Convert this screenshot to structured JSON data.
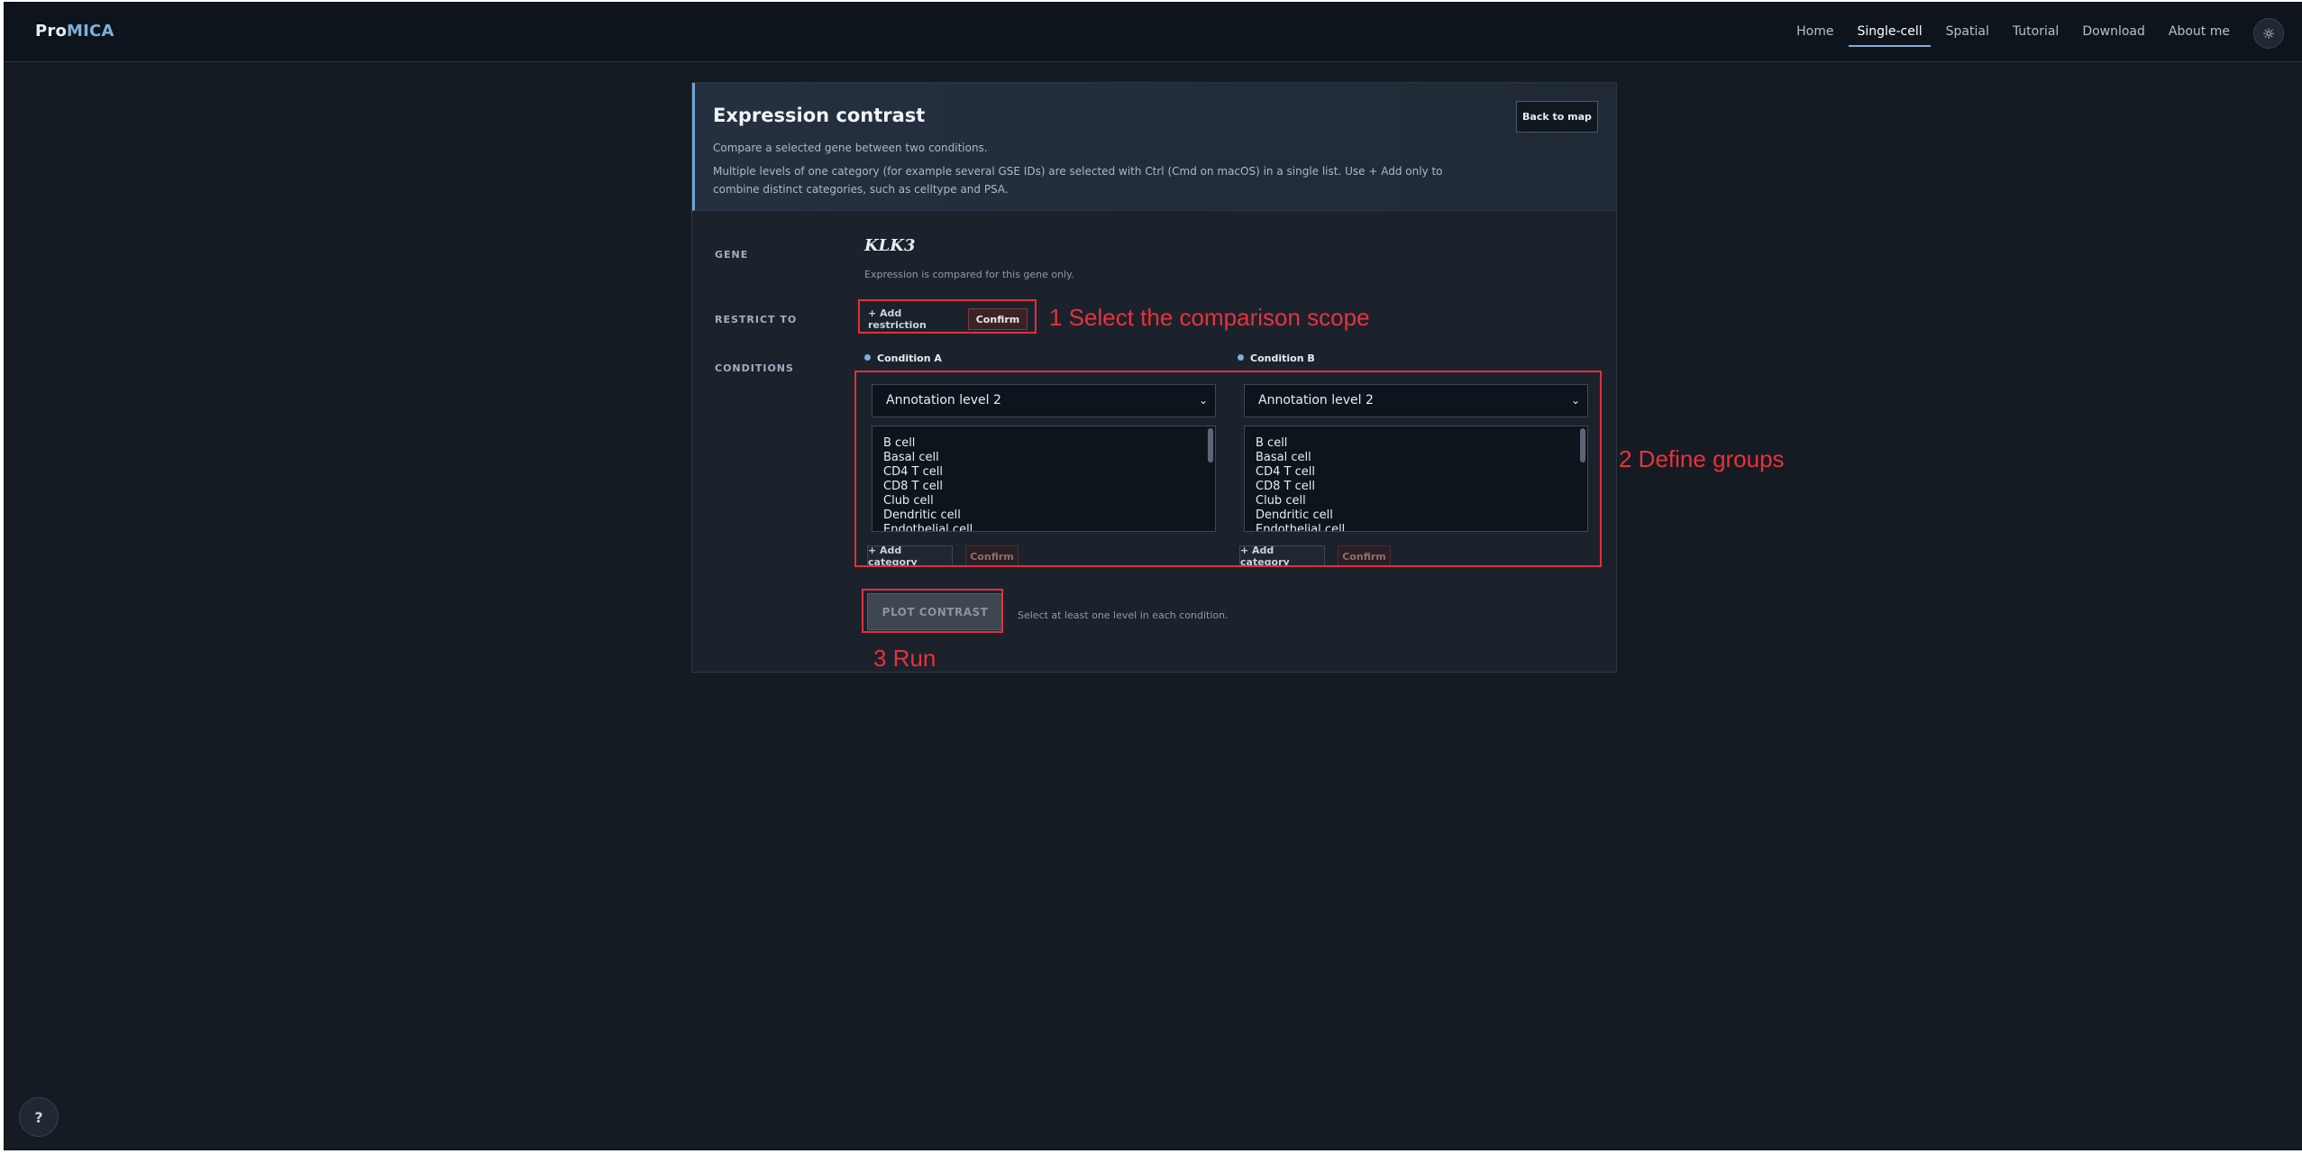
{
  "brand": {
    "part1": "Pro",
    "part2": "MICA"
  },
  "nav": {
    "items": [
      "Home",
      "Single-cell",
      "Spatial",
      "Tutorial",
      "Download",
      "About me"
    ],
    "active": "Single-cell"
  },
  "theme_icon": "sun-icon",
  "card": {
    "title": "Expression contrast",
    "subtitle": "Compare a selected gene between two conditions.",
    "note": "Multiple levels of one category (for example several GSE IDs) are selected with Ctrl (Cmd on macOS) in a single list. Use + Add only to combine distinct categories, such as celltype and PSA.",
    "back_label": "Back to map"
  },
  "gene": {
    "label": "GENE",
    "value": "KLK3",
    "hint": "Expression is compared for this gene only."
  },
  "restrict": {
    "label": "RESTRICT TO",
    "add_label": "+ Add restriction",
    "confirm_label": "Confirm"
  },
  "conditions": {
    "label": "CONDITIONS",
    "a": {
      "title": "Condition A",
      "select_value": "Annotation level 2",
      "items": [
        "B cell",
        "Basal cell",
        "CD4 T cell",
        "CD8 T cell",
        "Club cell",
        "Dendritic cell",
        "Endothelial cell"
      ],
      "add_label": "+ Add category",
      "confirm_label": "Confirm"
    },
    "b": {
      "title": "Condition B",
      "select_value": "Annotation level 2",
      "items": [
        "B cell",
        "Basal cell",
        "CD4 T cell",
        "CD8 T cell",
        "Club cell",
        "Dendritic cell",
        "Endothelial cell"
      ],
      "add_label": "+ Add category",
      "confirm_label": "Confirm"
    }
  },
  "plot": {
    "label": "PLOT CONTRAST",
    "hint": "Select at least one level in each condition."
  },
  "annotations": {
    "step1": "1 Select the comparison scope",
    "step2": "2 Define groups",
    "step3": "3 Run"
  },
  "help_label": "?",
  "colors": {
    "background": "#151b23",
    "accent": "#7fb0d9",
    "annotation": "#e8323c"
  }
}
